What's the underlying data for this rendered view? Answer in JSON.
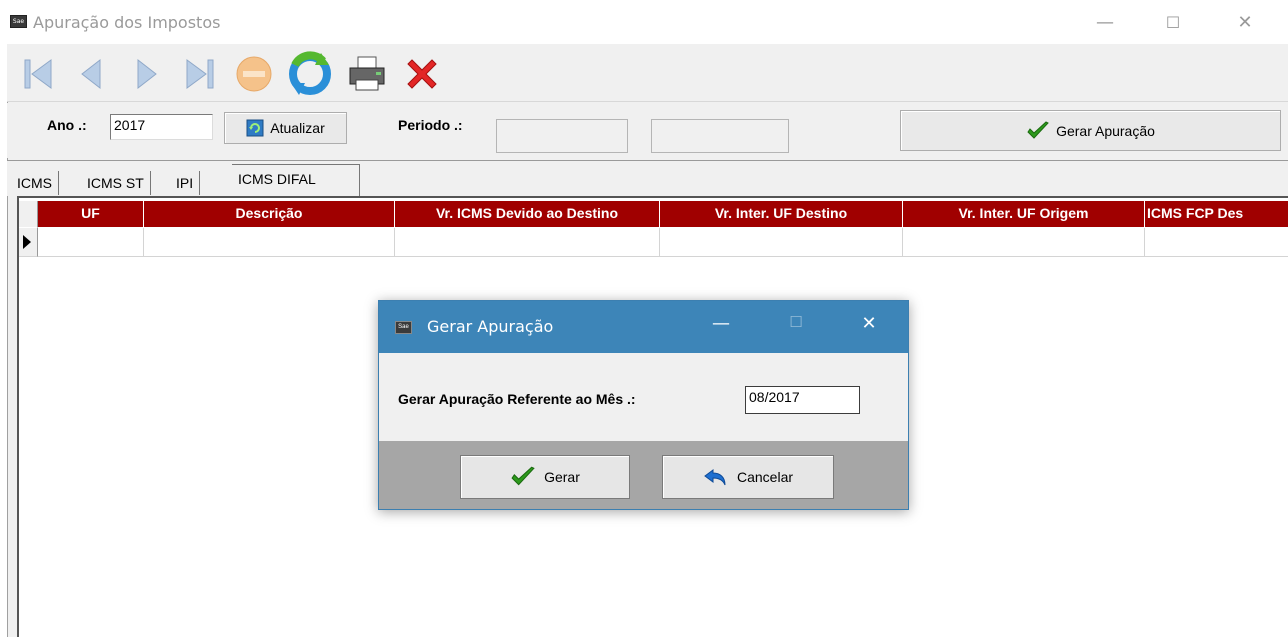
{
  "window": {
    "title": "Apuração dos Impostos",
    "icon_text": "Sae",
    "minimize": "—",
    "maximize": "☐",
    "close": "✕"
  },
  "toolbar": {
    "buttons": [
      "first-icon",
      "previous-icon",
      "next-icon",
      "last-icon",
      "cancel-edit-icon",
      "refresh-icon",
      "print-icon",
      "close-icon"
    ]
  },
  "filter": {
    "ano_label": "Ano .:",
    "ano_value": "2017",
    "atualizar_label": "Atualizar",
    "atualizar_underline": "t",
    "periodo_label": "Periodo .:",
    "periodo_start": "",
    "periodo_end": "",
    "gerar_label": "Gerar Apuração"
  },
  "tabs": [
    {
      "label": "ICMS",
      "active": false
    },
    {
      "label": "ICMS ST",
      "active": false
    },
    {
      "label": "IPI",
      "active": false
    },
    {
      "label": "ICMS DIFAL",
      "active": true
    }
  ],
  "grid": {
    "columns": [
      "UF",
      "Descrição",
      "Vr. ICMS Devido ao Destino",
      "Vr. Inter. UF Destino",
      "Vr. Inter. UF Origem",
      "ICMS FCP Des"
    ],
    "rows": [
      [
        "",
        "",
        "",
        "",
        "",
        ""
      ]
    ]
  },
  "dialog": {
    "title": "Gerar Apuração",
    "icon_text": "Sae",
    "prompt": "Gerar Apuração Referente ao Mês .:",
    "month_value": "08/2017",
    "gerar_label": "Gerar",
    "cancelar_label": "Cancelar"
  },
  "colors": {
    "grid_header": "#a00000",
    "dialog_title": "#3d85b8",
    "dialog_footer": "#a6a6a6"
  }
}
